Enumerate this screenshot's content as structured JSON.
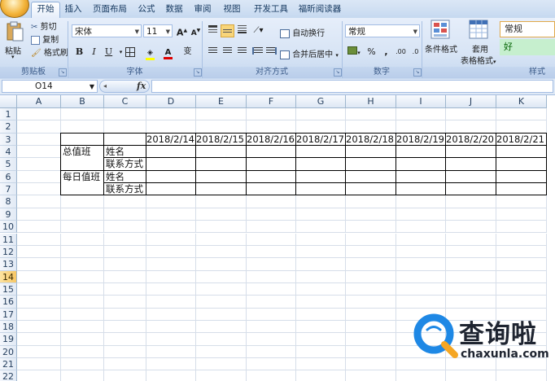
{
  "ribbon": {
    "tabs": [
      "开始",
      "插入",
      "页面布局",
      "公式",
      "数据",
      "审阅",
      "视图",
      "开发工具",
      "福昕阅读器"
    ],
    "clipboard": {
      "paste": "粘贴",
      "cut": "剪切",
      "copy": "复制",
      "format_painter": "格式刷",
      "label": "剪贴板"
    },
    "font": {
      "name": "宋体",
      "size": "11",
      "grow": "A",
      "shrink": "A",
      "bold": "B",
      "italic": "I",
      "underline": "U",
      "phonetic": "变",
      "label": "字体"
    },
    "alignment": {
      "wrap": "自动换行",
      "merge": "合并后居中",
      "label": "对齐方式"
    },
    "number": {
      "format": "常规",
      "percent": "%",
      "comma": ",",
      "label": "数字"
    },
    "styles": {
      "conditional": "条件格式",
      "table_line1": "套用",
      "table_line2": "表格格式",
      "normal": "常规",
      "good": "好",
      "label": "样式"
    }
  },
  "formula_bar": {
    "name_box": "O14",
    "fx": "fx",
    "value": ""
  },
  "columns": [
    "A",
    "B",
    "C",
    "D",
    "E",
    "F",
    "G",
    "H",
    "I",
    "J",
    "K"
  ],
  "rows": [
    "1",
    "2",
    "3",
    "4",
    "5",
    "6",
    "7",
    "8",
    "9",
    "10",
    "11",
    "12",
    "13",
    "14",
    "15",
    "16",
    "17",
    "18",
    "19",
    "20",
    "21",
    "22"
  ],
  "active_row": "14",
  "sheet": {
    "dates": [
      "2018/2/14",
      "2018/2/15",
      "2018/2/16",
      "2018/2/17",
      "2018/2/18",
      "2018/2/19",
      "2018/2/20",
      "2018/2/21"
    ],
    "b4": "总值班",
    "b6": "每日值班",
    "c4": "姓名",
    "c5": "联系方式",
    "c6": "姓名",
    "c7": "联系方式"
  },
  "watermark": {
    "brand": "查询啦",
    "url": "chaxunla.com"
  },
  "colors": {
    "accent": "#4c7fc4",
    "active_row": "#f7c765",
    "good_style": "#c6efce",
    "watermark_blue": "#1e88e5"
  }
}
